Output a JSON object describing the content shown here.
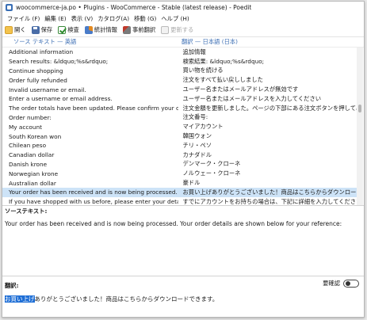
{
  "window": {
    "title": "woocommerce-ja.po • Plugins - WooCommerce - Stable (latest release) - Poedit"
  },
  "menu": [
    "ファイル (F)",
    "編集 (E)",
    "表示 (V)",
    "カタログ(A)",
    "移動 (G)",
    "ヘルプ (H)"
  ],
  "toolbar": {
    "open": "開く",
    "save": "保存",
    "validate": "検査",
    "stats": "統計情報",
    "pretranslate": "事前翻訳",
    "update": "更新する"
  },
  "list": {
    "source_header": "ソース テキスト — 英語",
    "translation_header": "翻訳 — 日本語 (日本)",
    "rows": [
      {
        "source": "Additional information",
        "translation": "追加情報"
      },
      {
        "source": "Search results: &ldquo;%s&rdquo;",
        "translation": "検索結果: &ldquo;%s&rdquo;"
      },
      {
        "source": "Continue shopping",
        "translation": "買い物を続ける"
      },
      {
        "source": "Order fully refunded",
        "translation": "注文をすべて払い戻ししました"
      },
      {
        "source": "Invalid username or email.",
        "translation": "ユーザー名またはメールアドレスが無効です"
      },
      {
        "source": "Enter a username or email address.",
        "translation": "ユーザー名またはメールアドレスを入力してください"
      },
      {
        "source": "The order totals have been updated. Please confirm your order by p...",
        "translation": "注文金額を更新しました。ページの下部にある注文ボタンを押して、注文を確..."
      },
      {
        "source": "Order number:",
        "translation": "注文番号:"
      },
      {
        "source": "My account",
        "translation": "マイアカウント"
      },
      {
        "source": "South Korean won",
        "translation": "韓国ウォン"
      },
      {
        "source": "Chilean peso",
        "translation": "チリ・ペソ"
      },
      {
        "source": "Canadian dollar",
        "translation": "カナダドル"
      },
      {
        "source": "Danish krone",
        "translation": "デンマーク・クローネ"
      },
      {
        "source": "Norwegian krone",
        "translation": "ノルウェー・クローネ"
      },
      {
        "source": "Australian dollar",
        "translation": "豪ドル"
      },
      {
        "source": "Your order has been received and is now being processed. Your ord...",
        "translation": "お買い上げありがとうございました！商品はこちらからダウンロードできます。"
      },
      {
        "source": "If you have shopped with us before, please enter your details in the...",
        "translation": "すでにアカウントをお持ちの場合は、下記に詳細を入力してください。新規のお..."
      }
    ],
    "selected_index": 15
  },
  "source_panel": {
    "label": "ソーステキスト:",
    "text": "Your order has been received and is now being processed. Your order details are shown below for your reference:"
  },
  "translation_panel": {
    "label": "翻訳:",
    "fuzzy_label": "要確認",
    "text_highlight": "お買い上げ",
    "text_rest": "ありがとうございました！商品はこちらからダウンロードできます。"
  }
}
